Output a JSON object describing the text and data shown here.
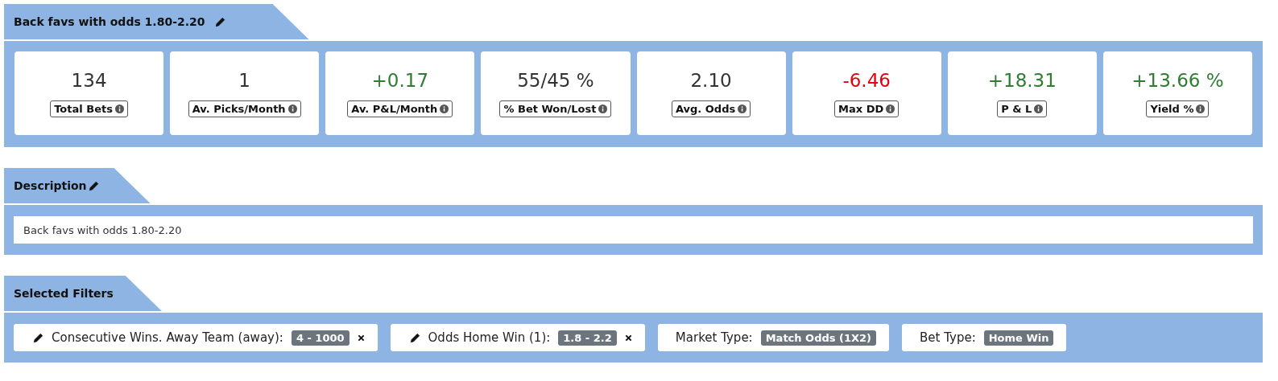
{
  "strategy": {
    "title": "Back favs with odds 1.80-2.20",
    "editable": true,
    "stats": [
      {
        "value": "134",
        "label": "Total Bets",
        "color": "#333333"
      },
      {
        "value": "1",
        "label": "Av. Picks/Month",
        "color": "#333333"
      },
      {
        "value": "+0.17",
        "label": "Av. P&L/Month",
        "color": "#2e7d32"
      },
      {
        "value": "55/45 %",
        "label": "% Bet Won/Lost",
        "color": "#333333"
      },
      {
        "value": "2.10",
        "label": "Avg. Odds",
        "color": "#333333"
      },
      {
        "value": "-6.46",
        "label": "Max DD",
        "color": "#e3000f"
      },
      {
        "value": "+18.31",
        "label": "P & L",
        "color": "#2e7d32"
      },
      {
        "value": "+13.66 %",
        "label": "Yield %",
        "color": "#2e7d32"
      }
    ]
  },
  "description": {
    "title": "Description",
    "editable": true,
    "value": "Back favs with odds 1.80-2.20"
  },
  "filters": {
    "title": "Selected Filters",
    "items": [
      {
        "label": "Consecutive Wins. Away Team (away):",
        "value": "4 - 1000",
        "editable": true,
        "removable": true
      },
      {
        "label": "Odds Home Win (1):",
        "value": "1.8 - 2.2",
        "editable": true,
        "removable": true
      },
      {
        "label": "Market Type:",
        "value": "Match Odds (1X2)",
        "editable": false,
        "removable": false
      },
      {
        "label": "Bet Type:",
        "value": "Home Win",
        "editable": false,
        "removable": false
      }
    ]
  }
}
